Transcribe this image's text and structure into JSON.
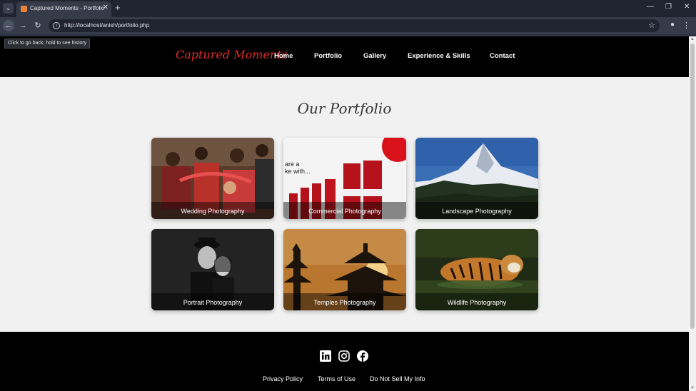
{
  "browser": {
    "tab_title": "Captured Moments - Portfolio",
    "url": "http://localhost/anish/portfolio.php",
    "tooltip": "Click to go back, hold to see history"
  },
  "site": {
    "logo": "Captured Moments",
    "nav": [
      "Home",
      "Portfolio",
      "Gallery",
      "Experience & Skills",
      "Contact"
    ],
    "section_title": "Our Portfolio",
    "cards": [
      "Wedding Photography",
      "Commercial Photography",
      "Landscape Photography",
      "Portrait Photography",
      "Temples Photography",
      "Wildlife Photography"
    ],
    "social": [
      "linkedin-icon",
      "instagram-icon",
      "facebook-icon"
    ],
    "footer_links": [
      "Privacy Policy",
      "Terms of Use",
      "Do Not Sell My Info"
    ]
  },
  "colors": {
    "logo": "#e22b2b",
    "header_bg": "#000000",
    "page_bg": "#f1f1f1"
  }
}
